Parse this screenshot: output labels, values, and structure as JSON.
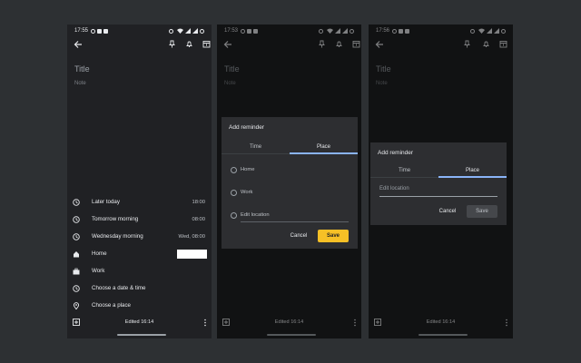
{
  "screens": [
    {
      "status_time": "17:55",
      "title_placeholder": "Title",
      "note_placeholder": "Note",
      "menu": [
        {
          "icon": "clock-icon",
          "label": "Later today",
          "value": "18:00"
        },
        {
          "icon": "clock-icon",
          "label": "Tomorrow morning",
          "value": "08:00"
        },
        {
          "icon": "clock-icon",
          "label": "Wednesday morning",
          "value": "Wed, 08:00"
        },
        {
          "icon": "home-icon",
          "label": "Home",
          "value": ""
        },
        {
          "icon": "briefcase-icon",
          "label": "Work",
          "value": ""
        },
        {
          "icon": "clock-icon",
          "label": "Choose a date & time",
          "value": ""
        },
        {
          "icon": "location-pin-icon",
          "label": "Choose a place",
          "value": ""
        }
      ],
      "edited": "Edited 16:14"
    },
    {
      "status_time": "17:53",
      "title_placeholder": "Title",
      "note_placeholder": "Note",
      "edited": "Edited 16:14",
      "dialog": {
        "title": "Add reminder",
        "tabs": [
          "Time",
          "Place"
        ],
        "selected_tab": "Place",
        "options": [
          "Home",
          "Work",
          "Edit location"
        ],
        "cancel": "Cancel",
        "save": "Save"
      }
    },
    {
      "status_time": "17:56",
      "title_placeholder": "Title",
      "note_placeholder": "Note",
      "edited": "Edited 16:14",
      "dialog": {
        "title": "Add reminder",
        "tabs": [
          "Time",
          "Place"
        ],
        "selected_tab": "Place",
        "location_placeholder": "Edit location",
        "cancel": "Cancel",
        "save": "Save"
      }
    }
  ],
  "colors": {
    "background": "#2d3033",
    "surface": "#202124",
    "dialog": "#2d2e31",
    "accent_blue": "#8ab4f8",
    "save_yellow": "#f6c026"
  }
}
